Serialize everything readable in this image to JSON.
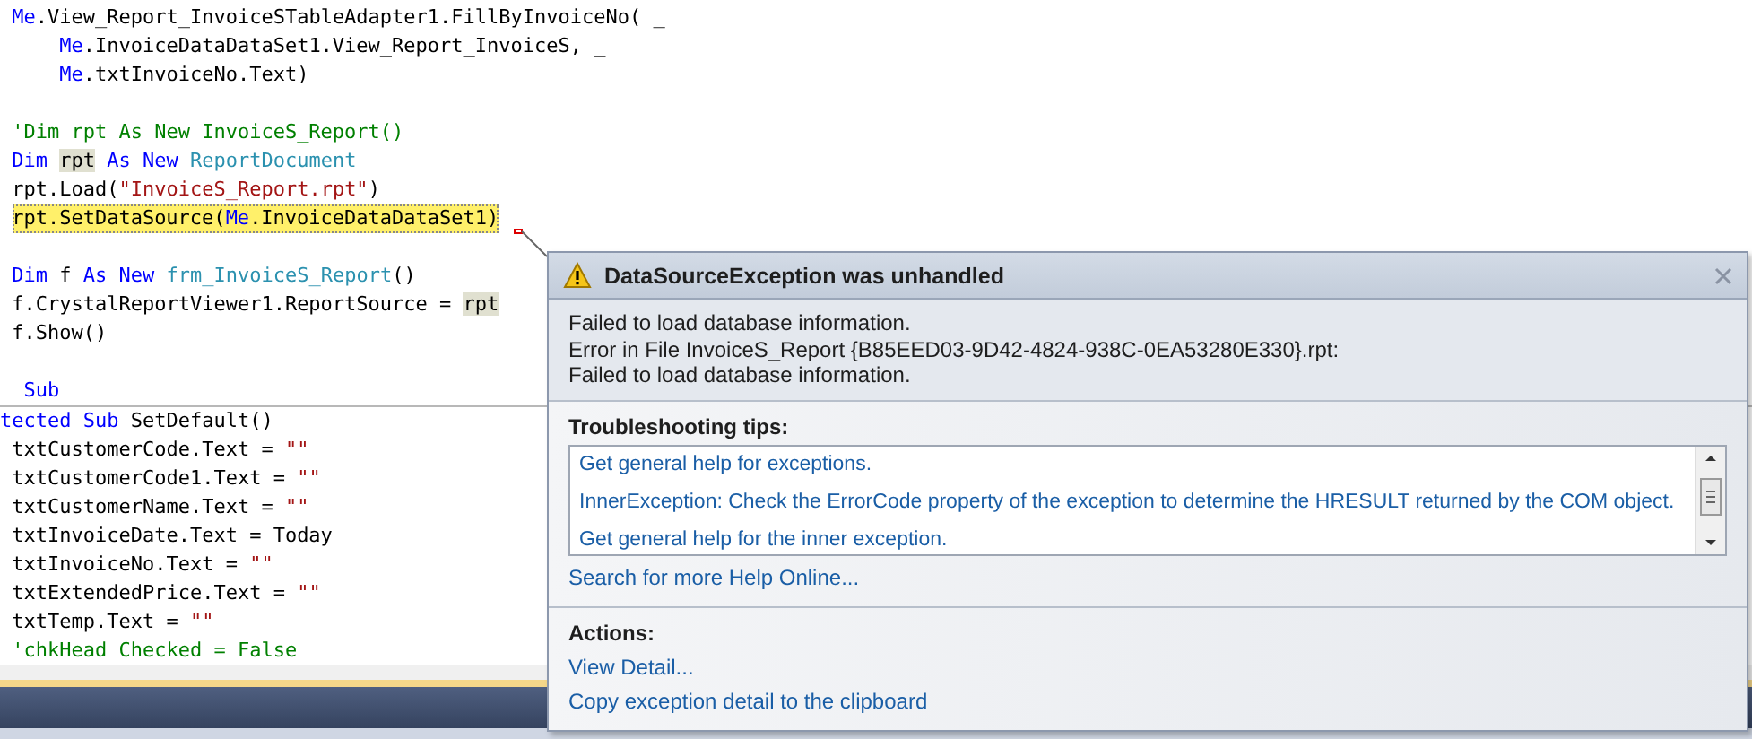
{
  "editor": {
    "sections": [
      {
        "lines": [
          {
            "kind": "code",
            "tokens": [
              {
                "kind": "kw",
                "text": " Me"
              },
              {
                "kind": "plain",
                "text": ".View_Report_InvoiceSTableAdapter1.FillByInvoiceNo( _"
              }
            ]
          },
          {
            "kind": "code",
            "tokens": [
              {
                "kind": "kw",
                "text": "     Me"
              },
              {
                "kind": "plain",
                "text": ".InvoiceDataDataSet1.View_Report_InvoiceS, _"
              }
            ]
          },
          {
            "kind": "code",
            "tokens": [
              {
                "kind": "kw",
                "text": "     Me"
              },
              {
                "kind": "plain",
                "text": ".txtInvoiceNo.Text)"
              }
            ]
          },
          {
            "kind": "blank"
          },
          {
            "kind": "code",
            "tokens": [
              {
                "kind": "comment",
                "text": " 'Dim rpt As New InvoiceS_Report()"
              }
            ]
          },
          {
            "kind": "code",
            "tokens": [
              {
                "kind": "kw",
                "text": " Dim "
              },
              {
                "kind": "ref",
                "text": "rpt"
              },
              {
                "kind": "kw",
                "text": " As New "
              },
              {
                "kind": "type",
                "text": "ReportDocument"
              }
            ]
          },
          {
            "kind": "code",
            "tokens": [
              {
                "kind": "plain",
                "text": " rpt.Load("
              },
              {
                "kind": "str",
                "text": "\"InvoiceS_Report.rpt\""
              },
              {
                "kind": "plain",
                "text": ")"
              }
            ]
          },
          {
            "kind": "code",
            "current": true,
            "tokens": [
              {
                "kind": "plain",
                "text": "rpt.SetDataSource("
              },
              {
                "kind": "kw",
                "text": "Me"
              },
              {
                "kind": "plain",
                "text": ".InvoiceDataDataSet1)"
              }
            ]
          },
          {
            "kind": "blank"
          },
          {
            "kind": "code",
            "tokens": [
              {
                "kind": "kw",
                "text": " Dim"
              },
              {
                "kind": "plain",
                "text": " f "
              },
              {
                "kind": "kw",
                "text": "As New "
              },
              {
                "kind": "type",
                "text": "frm_InvoiceS_Report"
              },
              {
                "kind": "plain",
                "text": "()"
              }
            ]
          },
          {
            "kind": "code",
            "tokens": [
              {
                "kind": "plain",
                "text": " f.CrystalReportViewer1.ReportSource = "
              },
              {
                "kind": "ref",
                "text": "rpt"
              }
            ]
          },
          {
            "kind": "code",
            "tokens": [
              {
                "kind": "plain",
                "text": " f.Show()"
              }
            ]
          },
          {
            "kind": "blank"
          },
          {
            "kind": "code",
            "tokens": [
              {
                "kind": "kw",
                "text": "  Sub"
              }
            ]
          }
        ]
      },
      {
        "lines": [
          {
            "kind": "code",
            "tokens": [
              {
                "kind": "kw",
                "text": "tected Sub"
              },
              {
                "kind": "plain",
                "text": " SetDefault()"
              }
            ]
          },
          {
            "kind": "code",
            "tokens": [
              {
                "kind": "plain",
                "text": " txtCustomerCode.Text = "
              },
              {
                "kind": "str",
                "text": "\"\""
              }
            ]
          },
          {
            "kind": "code",
            "tokens": [
              {
                "kind": "plain",
                "text": " txtCustomerCode1.Text = "
              },
              {
                "kind": "str",
                "text": "\"\""
              }
            ]
          },
          {
            "kind": "code",
            "tokens": [
              {
                "kind": "plain",
                "text": " txtCustomerName.Text = "
              },
              {
                "kind": "str",
                "text": "\"\""
              }
            ]
          },
          {
            "kind": "code",
            "tokens": [
              {
                "kind": "plain",
                "text": " txtInvoiceDate.Text = Today"
              }
            ]
          },
          {
            "kind": "code",
            "tokens": [
              {
                "kind": "plain",
                "text": " txtInvoiceNo.Text = "
              },
              {
                "kind": "str",
                "text": "\"\""
              }
            ]
          },
          {
            "kind": "code",
            "tokens": [
              {
                "kind": "plain",
                "text": " txtExtendedPrice.Text = "
              },
              {
                "kind": "str",
                "text": "\"\""
              }
            ]
          },
          {
            "kind": "code",
            "tokens": [
              {
                "kind": "plain",
                "text": " txtTemp.Text = "
              },
              {
                "kind": "str",
                "text": "\"\""
              }
            ]
          },
          {
            "kind": "code",
            "tokens": [
              {
                "kind": "comment",
                "text": " 'chkHead Checked = False"
              }
            ]
          }
        ]
      }
    ]
  },
  "exception_popup": {
    "title": "DataSourceException was unhandled",
    "message": [
      "Failed to load database information.",
      "Error in File InvoiceS_Report {B85EED03-9D42-4824-938C-0EA53280E330}.rpt:",
      "Failed to load database information."
    ],
    "troubleshooting": {
      "heading": "Troubleshooting tips:",
      "tips": [
        "Get general help for exceptions.",
        "InnerException: Check the ErrorCode property of the exception to determine the HRESULT returned by the COM object.",
        "Get general help for the inner exception."
      ],
      "search_link": "Search for more Help Online..."
    },
    "actions": {
      "heading": "Actions:",
      "links": [
        "View Detail...",
        "Copy exception detail to the clipboard"
      ]
    }
  }
}
